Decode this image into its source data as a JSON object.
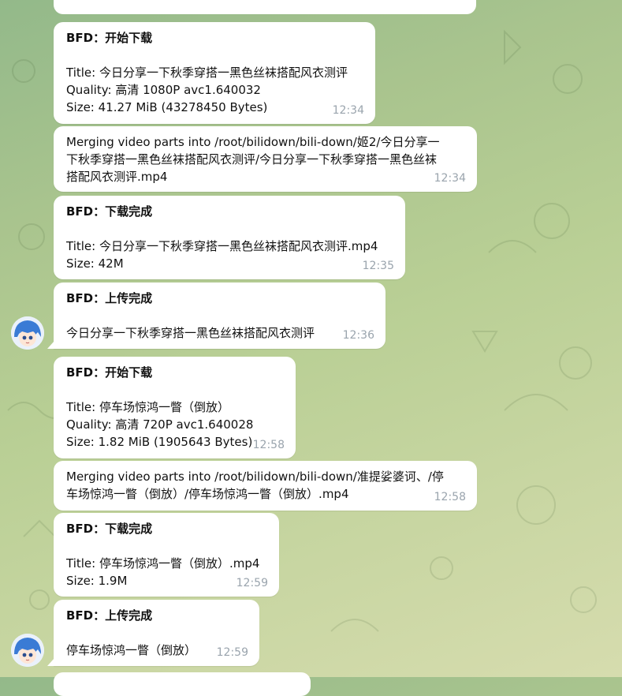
{
  "messages": [
    {
      "title": "BFD：开始下载",
      "lines": [
        "Title: 今日分享一下秋季穿搭一黑色丝袜搭配风衣测评",
        "Quality: 高清 1080P avc1.640032",
        "Size: 41.27 MiB (43278450 Bytes)"
      ],
      "time": "12:34"
    },
    {
      "lines": [
        "Merging video parts into /root/bilidown/bili-down/姬2/今日分享一",
        "下秋季穿搭一黑色丝袜搭配风衣测评/今日分享一下秋季穿搭一黑色丝袜",
        "搭配风衣测评.mp4"
      ],
      "time": "12:34"
    },
    {
      "title": "BFD：下载完成",
      "lines": [
        "Title: 今日分享一下秋季穿搭一黑色丝袜搭配风衣测评.mp4",
        "Size: 42M"
      ],
      "time": "12:35"
    },
    {
      "title": "BFD：上传完成",
      "lines": [
        "今日分享一下秋季穿搭一黑色丝袜搭配风衣测评"
      ],
      "time": "12:36"
    },
    {
      "title": "BFD：开始下载",
      "lines": [
        "Title: 停车场惊鸿一瞥（倒放）",
        "Quality: 高清 720P avc1.640028",
        "Size: 1.82 MiB (1905643 Bytes)"
      ],
      "time": "12:58"
    },
    {
      "lines": [
        "Merging video parts into /root/bilidown/bili-down/准提娑婆诃、/停",
        "车场惊鸿一瞥（倒放）/停车场惊鸿一瞥（倒放）.mp4"
      ],
      "time": "12:58"
    },
    {
      "title": "BFD：下载完成",
      "lines": [
        "Title: 停车场惊鸿一瞥（倒放）.mp4",
        "Size: 1.9M"
      ],
      "time": "12:59"
    },
    {
      "title": "BFD：上传完成",
      "lines": [
        "停车场惊鸿一瞥（倒放）"
      ],
      "time": "12:59"
    }
  ],
  "colors": {
    "bubble": "#ffffff",
    "time": "#9aa4ad",
    "avatar_hair": "#3a7bd5"
  }
}
